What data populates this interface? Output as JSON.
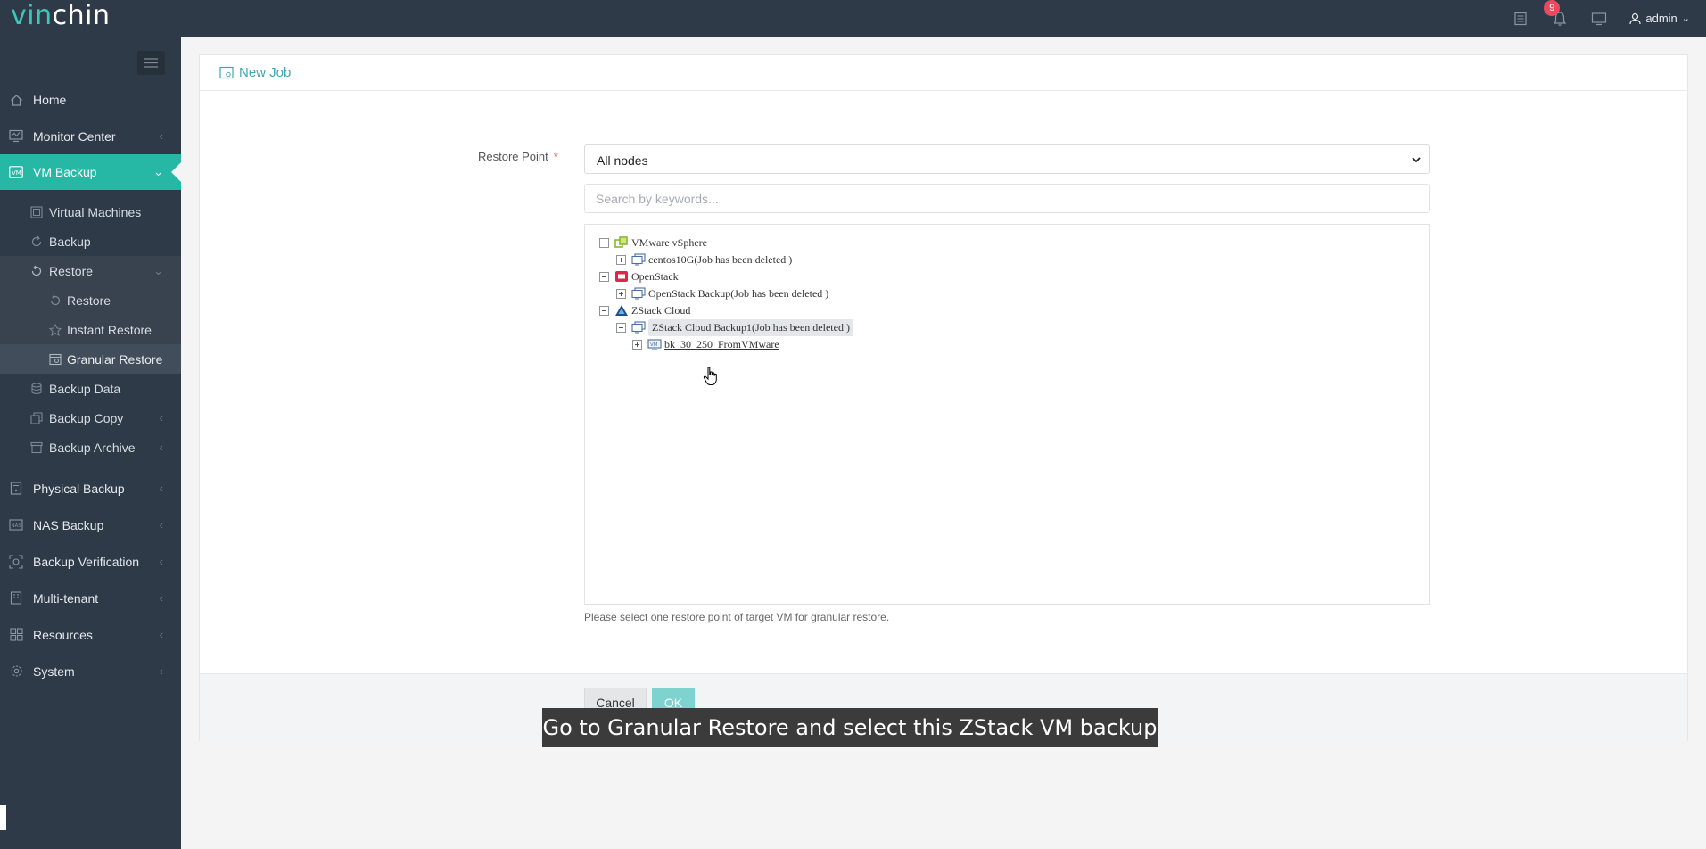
{
  "app": {
    "logo_part1": "vin",
    "logo_part2": "chin",
    "notification_count": "9",
    "user": "admin",
    "accent_color": "#26b8a4",
    "topbar_color": "#2f3a48"
  },
  "sidebar": {
    "items": [
      {
        "label": "Home",
        "icon": "home-icon"
      },
      {
        "label": "Monitor Center",
        "icon": "monitor-icon"
      },
      {
        "label": "VM Backup",
        "icon": "vm-icon"
      },
      {
        "label": "Physical Backup",
        "icon": "physical-icon"
      },
      {
        "label": "NAS Backup",
        "icon": "nas-icon"
      },
      {
        "label": "Backup Verification",
        "icon": "verification-icon"
      },
      {
        "label": "Multi-tenant",
        "icon": "tenant-icon"
      },
      {
        "label": "Resources",
        "icon": "resources-icon"
      },
      {
        "label": "System",
        "icon": "system-icon"
      }
    ],
    "vm_backup_sub": [
      {
        "label": "Virtual Machines"
      },
      {
        "label": "Backup"
      },
      {
        "label": "Restore"
      },
      {
        "label": "Backup Data"
      },
      {
        "label": "Backup Copy"
      },
      {
        "label": "Backup Archive"
      }
    ],
    "restore_sub": [
      {
        "label": "Restore"
      },
      {
        "label": "Instant Restore"
      },
      {
        "label": "Granular Restore"
      }
    ]
  },
  "page": {
    "title": "New Job",
    "restore_point_label": "Restore Point",
    "required_mark": "*",
    "select_value": "All nodes",
    "search_placeholder": "Search by keywords...",
    "hint": "Please select one restore point of target VM for granular restore.",
    "cancel_label": "Cancel",
    "ok_label": "OK"
  },
  "tree": {
    "vsphere": "VMware vSphere",
    "vsphere_job": "centos10G(Job has been deleted )",
    "openstack": "OpenStack",
    "openstack_job": "OpenStack Backup(Job has been deleted )",
    "zstack": "ZStack Cloud",
    "zstack_job": "ZStack Cloud Backup1(Job has been deleted )",
    "zstack_vm": "bk_30_250_FromVMware"
  },
  "caption": "Go to Granular Restore and select this ZStack VM backup"
}
